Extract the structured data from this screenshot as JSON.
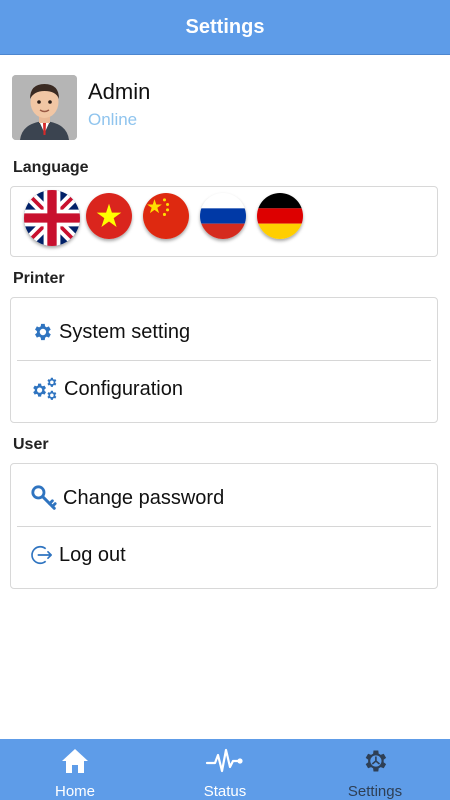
{
  "header": {
    "title": "Settings"
  },
  "profile": {
    "name": "Admin",
    "status": "Online"
  },
  "sections": {
    "language": {
      "label": "Language",
      "flags": [
        {
          "name": "uk-flag-icon",
          "selected": true
        },
        {
          "name": "vietnam-flag-icon",
          "selected": false
        },
        {
          "name": "china-flag-icon",
          "selected": false
        },
        {
          "name": "russia-flag-icon",
          "selected": false
        },
        {
          "name": "germany-flag-icon",
          "selected": false
        }
      ]
    },
    "printer": {
      "label": "Printer",
      "items": [
        {
          "label": "System setting",
          "icon": "gear-icon"
        },
        {
          "label": "Configuration",
          "icon": "gears-icon"
        }
      ]
    },
    "user": {
      "label": "User",
      "items": [
        {
          "label": "Change password",
          "icon": "key-icon"
        },
        {
          "label": "Log out",
          "icon": "logout-icon"
        }
      ]
    }
  },
  "tabs": [
    {
      "label": "Home",
      "icon": "home-icon",
      "active": false
    },
    {
      "label": "Status",
      "icon": "pulse-icon",
      "active": false
    },
    {
      "label": "Settings",
      "icon": "settings-icon",
      "active": true
    }
  ],
  "colors": {
    "accent": "#5e9ce8",
    "icon_blue": "#2f74c0",
    "status": "#8fc4ee",
    "active_tab": "#2e3f55"
  }
}
